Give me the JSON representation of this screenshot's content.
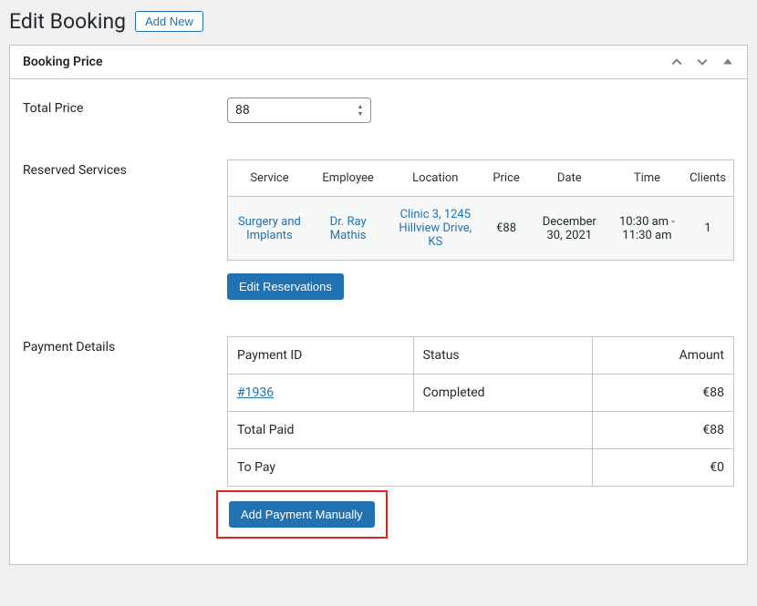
{
  "header": {
    "title": "Edit Booking",
    "add_new_label": "Add New"
  },
  "metabox": {
    "title": "Booking Price"
  },
  "total_price": {
    "label": "Total Price",
    "value": "88"
  },
  "reserved_services": {
    "label": "Reserved Services",
    "columns": {
      "service": "Service",
      "employee": "Employee",
      "location": "Location",
      "price": "Price",
      "date": "Date",
      "time": "Time",
      "clients": "Clients"
    },
    "row": {
      "service": "Surgery and Implants",
      "employee": "Dr. Ray Mathis",
      "location": "Clinic 3, 1245 Hillview Drive, KS",
      "price": "€88",
      "date": "December 30, 2021",
      "time": "10:30 am - 11:30 am",
      "clients": "1"
    },
    "edit_button": "Edit Reservations"
  },
  "payment_details": {
    "label": "Payment Details",
    "columns": {
      "payment_id": "Payment ID",
      "status": "Status",
      "amount": "Amount"
    },
    "row": {
      "payment_id": "#1936",
      "status": "Completed",
      "amount": "€88"
    },
    "total_paid_label": "Total Paid",
    "total_paid_value": "€88",
    "to_pay_label": "To Pay",
    "to_pay_value": "€0",
    "add_button": "Add Payment Manually"
  }
}
